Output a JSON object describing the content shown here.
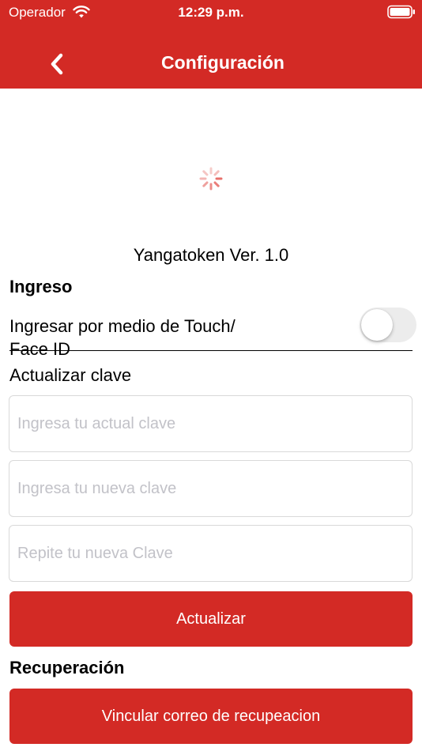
{
  "status_bar": {
    "carrier": "Operador",
    "time": "12:29 p.m.",
    "wifi_icon": "wifi-icon",
    "battery_icon": "battery-full-icon"
  },
  "header": {
    "title": "Configuración",
    "back_icon": "chevron-left-icon",
    "background_color": "#d32a25"
  },
  "loading": {
    "icon": "spinner-icon",
    "color": "#e8706b"
  },
  "version_label": "Yangatoken Ver. 1.0",
  "ingreso": {
    "title": "Ingreso",
    "touch_label": "Ingresar por medio de Touch/ Face ID",
    "touch_enabled": false
  },
  "actualizar_clave": {
    "title": "Actualizar clave",
    "current_password": {
      "value": "",
      "placeholder": "Ingresa tu actual clave"
    },
    "new_password": {
      "value": "",
      "placeholder": "Ingresa tu nueva clave"
    },
    "repeat_password": {
      "value": "",
      "placeholder": "Repite tu nueva Clave"
    },
    "submit_label": "Actualizar"
  },
  "recuperacion": {
    "title": "Recuperación",
    "link_email_label": "Vincular correo de recupeacion"
  },
  "colors": {
    "accent": "#d32a25",
    "placeholder": "#c2c2c8",
    "field_border": "#d9d9d9"
  }
}
